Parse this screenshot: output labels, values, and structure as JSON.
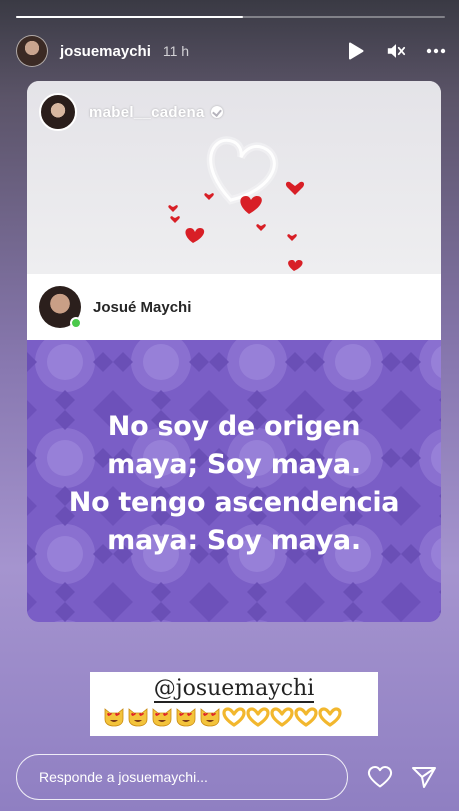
{
  "story": {
    "progress": 0.53,
    "username": "josuemaychi",
    "time": "11 h"
  },
  "shared": {
    "username": "mabel__cadena",
    "post_author": "Josué Maychi",
    "quote_lines": [
      "No soy de origen",
      "maya; Soy maya.",
      "No tengo ascendencia",
      "maya: Soy maya."
    ]
  },
  "mention": {
    "handle": "@josuemaychi",
    "emojis": [
      "heart-eyes-cat",
      "heart-eyes-cat",
      "heart-eyes-cat",
      "heart-eyes-cat",
      "heart-eyes-cat",
      "heart-hands",
      "heart-hands",
      "heart-hands",
      "heart-hands",
      "heart-hands"
    ]
  },
  "reply": {
    "placeholder": "Responde a josuemaychi..."
  },
  "colors": {
    "quote_bg": "#7a5ec6",
    "heart": "#d81f26",
    "online": "#4bc94b"
  }
}
